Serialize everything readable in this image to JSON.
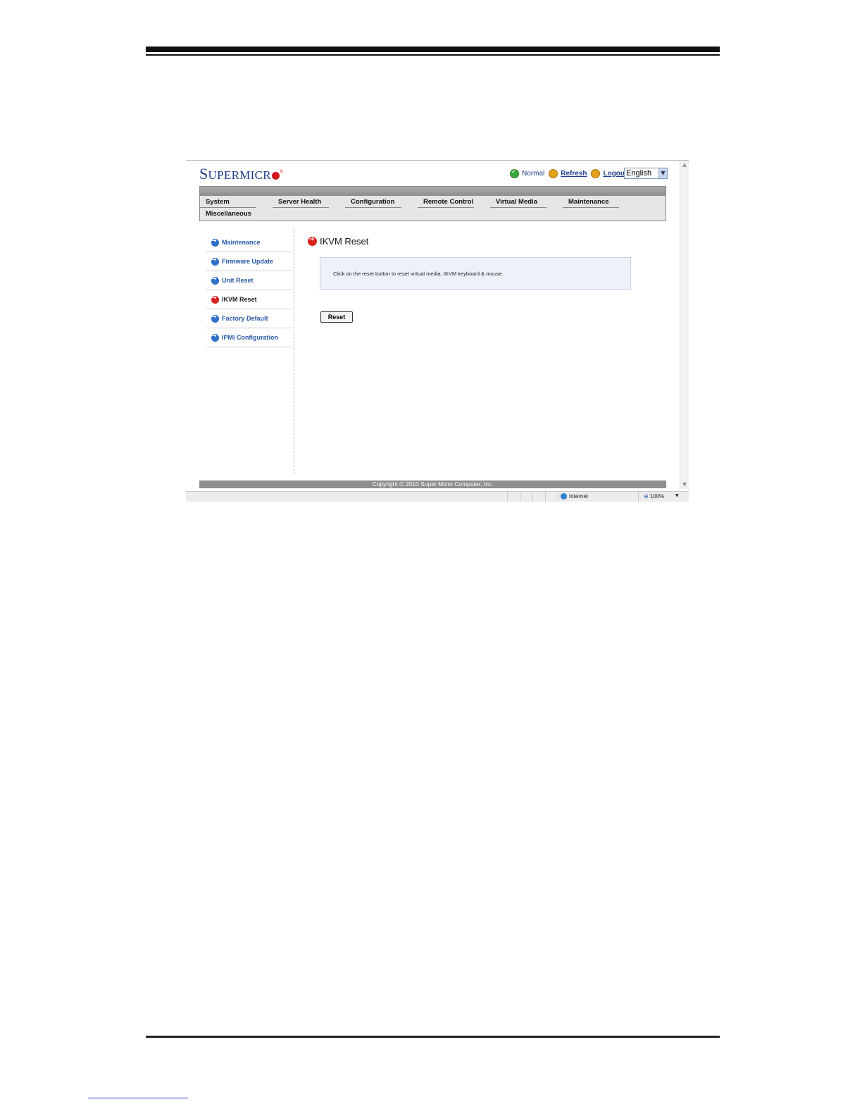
{
  "brand": {
    "logo_first": "S",
    "logo_rest": "UPERMICR",
    "logo_reg": "®",
    "brand_red": "#d5171e",
    "brand_blue": "#1e3a8a"
  },
  "header": {
    "status_label": "Normal",
    "refresh_label": "Refresh",
    "logout_label": "Logout",
    "language_selected": "English"
  },
  "nav": {
    "tabs": [
      "System",
      "Server Health",
      "Configuration",
      "Remote Control",
      "Virtual Media",
      "Maintenance"
    ],
    "second_row": "Miscellaneous"
  },
  "sidebar": {
    "items": [
      {
        "label": "Maintenance",
        "icon": "arrow-right-circle-icon",
        "active": false
      },
      {
        "label": "Firmware Update",
        "icon": "arrow-right-circle-icon",
        "active": false
      },
      {
        "label": "Unit Reset",
        "icon": "arrow-right-circle-icon",
        "active": false
      },
      {
        "label": "IKVM Reset",
        "icon": "arrow-right-circle-icon",
        "active": true
      },
      {
        "label": "Factory Default",
        "icon": "arrow-right-circle-icon",
        "active": false
      },
      {
        "label": "IPMI Configuration",
        "icon": "arrow-right-circle-icon",
        "active": false
      }
    ]
  },
  "main": {
    "title": "IKVM Reset",
    "description": "Click on the reset button to reset virtual media, IKVM keyboard & mouse.",
    "reset_button": "Reset"
  },
  "footer": {
    "copyright": "Copyright © 2010 Super Micro Computer, Inc."
  },
  "browser_status": {
    "zone": "Internet",
    "zoom": "100%"
  }
}
